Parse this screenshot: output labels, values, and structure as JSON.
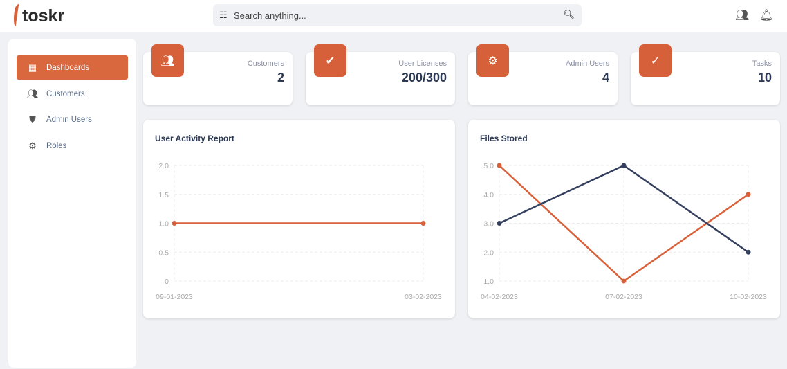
{
  "brand": "toskr",
  "search": {
    "placeholder": "Search anything..."
  },
  "sidebar": {
    "items": [
      {
        "label": "Dashboards",
        "active": true
      },
      {
        "label": "Customers"
      },
      {
        "label": "Admin Users"
      },
      {
        "label": "Roles"
      }
    ]
  },
  "stats": [
    {
      "label": "Customers",
      "value": "2"
    },
    {
      "label": "User Licenses",
      "value": "200/300"
    },
    {
      "label": "Admin Users",
      "value": "4"
    },
    {
      "label": "Tasks",
      "value": "10"
    }
  ],
  "colors": {
    "accent": "#d9613a",
    "navy": "#34405e"
  },
  "chart_data": [
    {
      "type": "line",
      "title": "User Activity Report",
      "categories": [
        "09-01-2023",
        "03-02-2023"
      ],
      "yticks": [
        "0",
        "0.5",
        "1.0",
        "1.5",
        "2.0"
      ],
      "ylim": [
        0,
        2
      ],
      "series": [
        {
          "name": "activity",
          "color": "#d9613a",
          "values": [
            1,
            1
          ]
        }
      ]
    },
    {
      "type": "line",
      "title": "Files Stored",
      "categories": [
        "04-02-2023",
        "07-02-2023",
        "10-02-2023"
      ],
      "yticks": [
        "1.0",
        "2.0",
        "3.0",
        "4.0",
        "5.0"
      ],
      "ylim": [
        1,
        5
      ],
      "series": [
        {
          "name": "series-orange",
          "color": "#d9613a",
          "values": [
            5,
            1,
            4
          ]
        },
        {
          "name": "series-navy",
          "color": "#34405e",
          "values": [
            3,
            5,
            2
          ]
        }
      ]
    }
  ]
}
